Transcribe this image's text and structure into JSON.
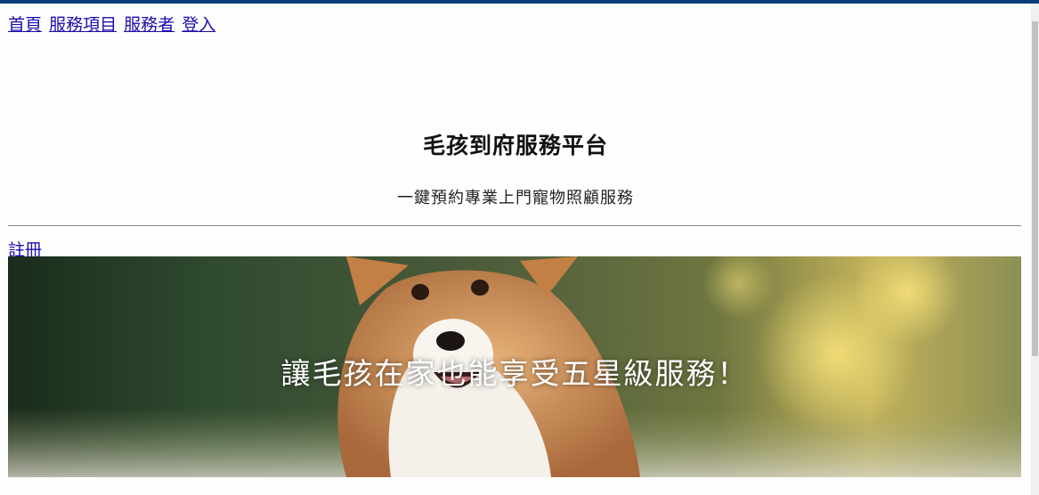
{
  "nav": {
    "items": [
      {
        "label": "首頁"
      },
      {
        "label": "服務項目"
      },
      {
        "label": "服務者"
      },
      {
        "label": "登入"
      }
    ]
  },
  "header": {
    "title": "毛孩到府服務平台",
    "subtitle": "一鍵預約專業上門寵物照顧服務"
  },
  "register_link": "註冊",
  "hero": {
    "caption": "讓毛孩在家也能享受五星級服務！"
  }
}
